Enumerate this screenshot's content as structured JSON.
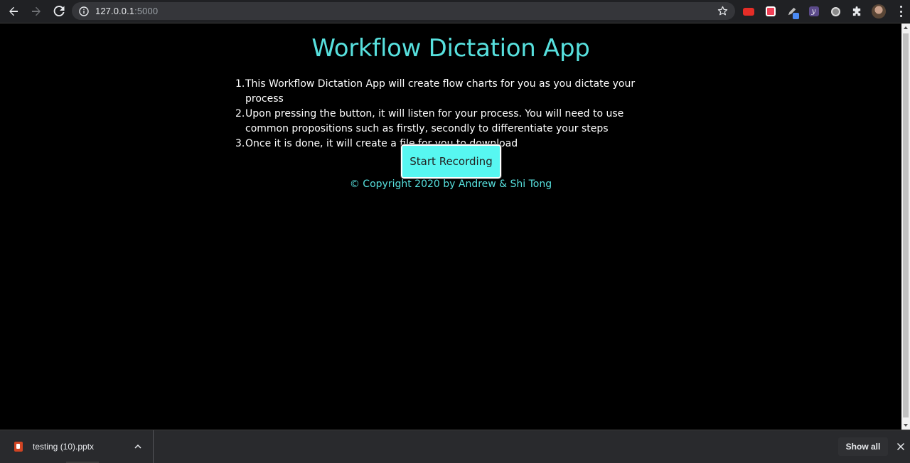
{
  "browser": {
    "url_host": "127.0.0.1",
    "url_port": ":5000"
  },
  "page": {
    "title": "Workflow Dictation App",
    "steps": [
      {
        "num": "1.",
        "text": "This Workflow Dictation App will create flow charts for you as you dictate your process"
      },
      {
        "num": "2.",
        "text": "Upon pressing the button, it will listen for your process. You will need to use common propositions such as firstly, secondly to differentiate your steps"
      },
      {
        "num": "3.",
        "text": "Once it is done, it will create a file for you to download"
      }
    ],
    "record_button": "Start Recording",
    "copyright": "© Copyright 2020 by Andrew & Shi Tong"
  },
  "downloads": {
    "file_name": "testing (10).pptx",
    "show_all": "Show all"
  },
  "colors": {
    "accent": "#57e0de",
    "button_bg": "#57f7f1",
    "page_bg": "#000000"
  }
}
